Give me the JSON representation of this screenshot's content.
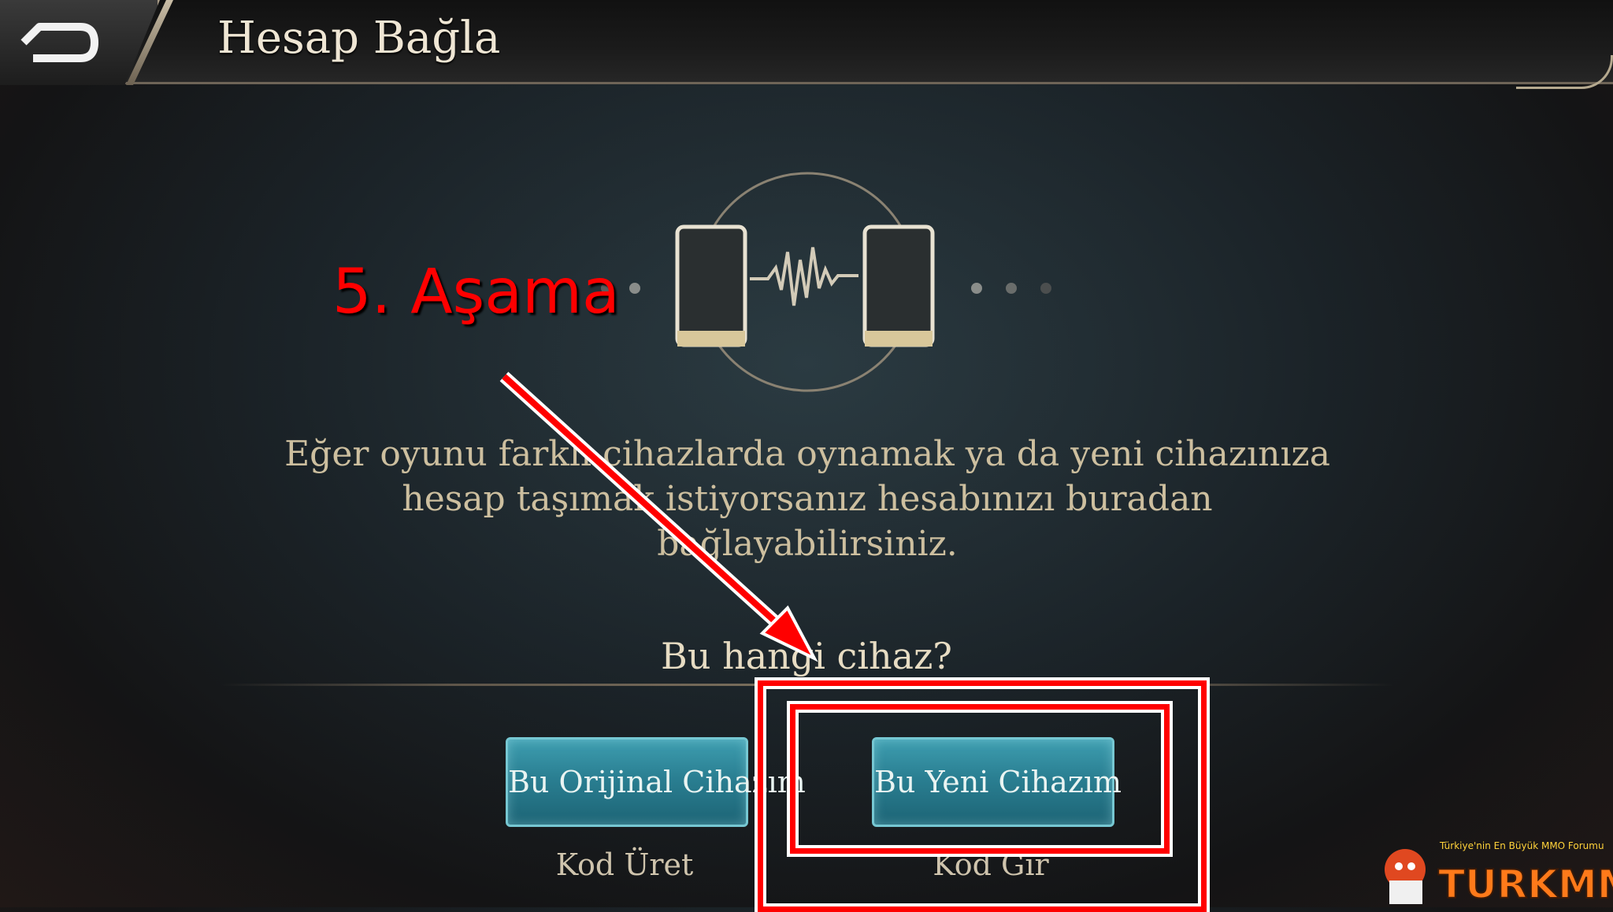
{
  "header": {
    "title": "Hesap Bağla",
    "back_icon": "back-arrow-icon"
  },
  "annotation": {
    "label": "5. Aşama",
    "color": "#ff0000"
  },
  "description": {
    "line1": "Eğer oyunu farklı cihazlarda oynamak ya da yeni cihazınıza",
    "line2": "hesap taşımak istiyorsanız hesabınızı buradan",
    "line3": "bağlayabilirsiniz."
  },
  "question": "Bu hangi cihaz?",
  "options": {
    "original": {
      "button_label": "Bu Orijinal Cihazım",
      "sub_label": "Kod Üret"
    },
    "new": {
      "button_label": "Bu Yeni Cihazım",
      "sub_label": "Kod Gir"
    }
  },
  "watermark": {
    "brand": "TURKMMO",
    "tagline": "Türkiye'nin En Büyük MMO Forumu"
  },
  "colors": {
    "accent_teal": "#2a7f92",
    "gold_text": "#cdbf9f",
    "highlight_red": "#ff0000"
  }
}
